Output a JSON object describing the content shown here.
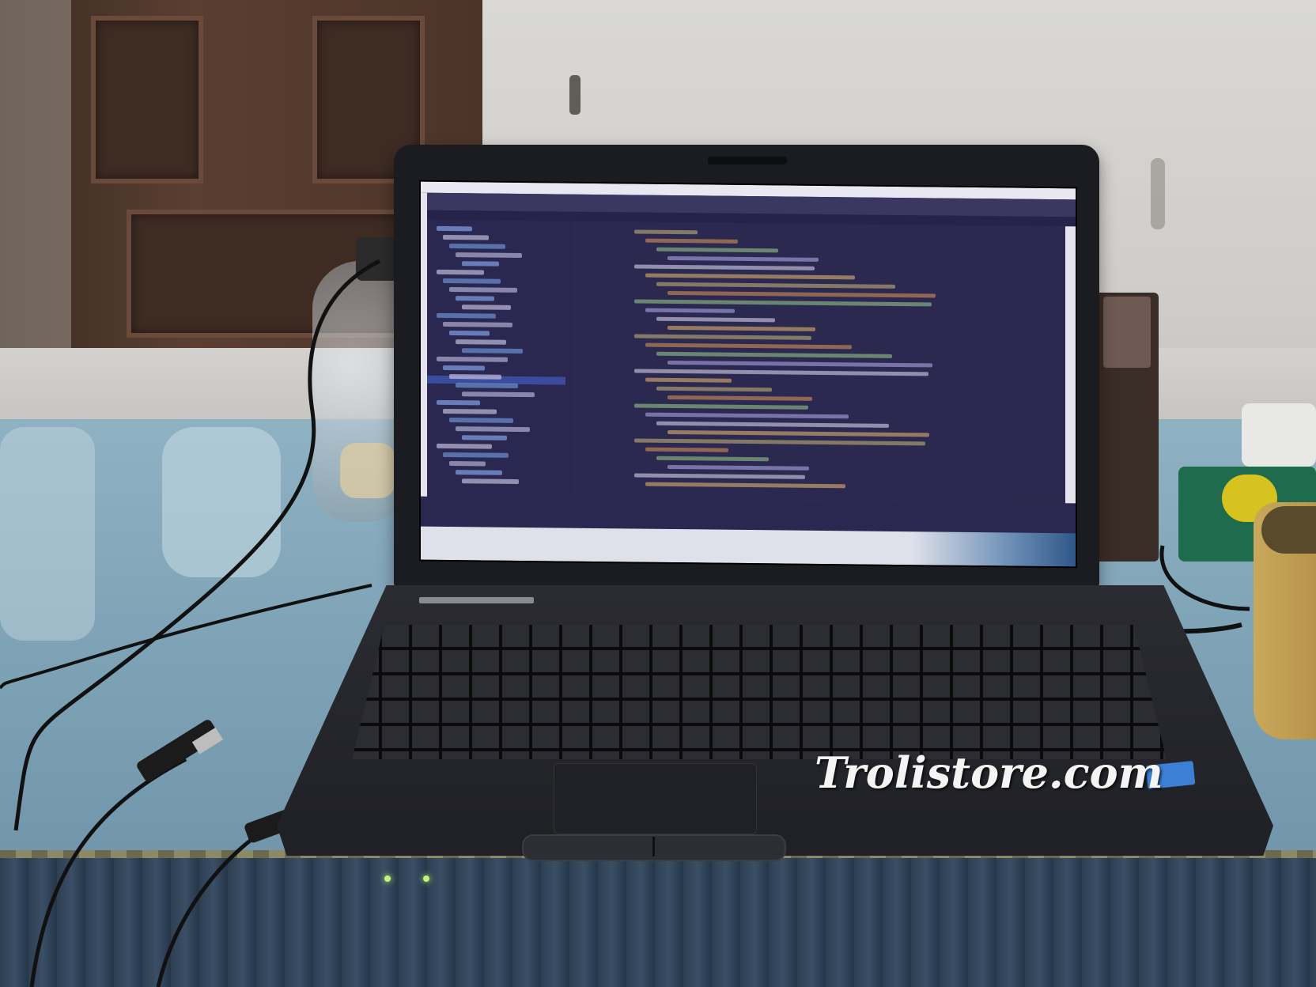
{
  "scene": {
    "description_tags": [
      "laptop",
      "code-editor",
      "table",
      "wall",
      "door",
      "cables"
    ],
    "watermark": "Trolistore.com"
  },
  "colors": {
    "editor_background": "#2c2951",
    "laptop_body": "#1e1f24",
    "tablecloth": "#7fa3b6",
    "table_edge": "#2e3f52"
  }
}
